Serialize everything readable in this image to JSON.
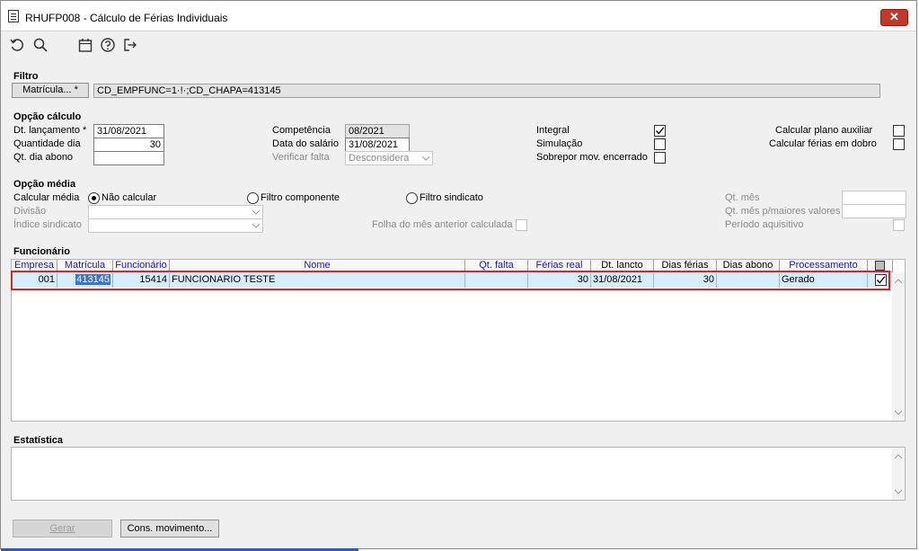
{
  "window": {
    "title": "RHUFP008 - Cálculo de Férias Individuais",
    "close_label": "✕"
  },
  "filtro": {
    "legend": "Filtro",
    "matricula_button": "Matrícula... *",
    "filter_value": "CD_EMPFUNC=1·!·;CD_CHAPA=413145"
  },
  "opcao_calculo": {
    "legend": "Opção cálculo",
    "dt_lancamento_label": "Dt. lançamento *",
    "dt_lancamento": "31/08/2021",
    "quantidade_dia_label": "Quantidade dia",
    "quantidade_dia": "30",
    "qt_dia_abono_label": "Qt. dia abono",
    "qt_dia_abono": "",
    "competencia_label": "Competência",
    "competencia": "08/2021",
    "data_salario_label": "Data do salário",
    "data_salario": "31/08/2021",
    "verificar_falta_label": "Verificar falta",
    "verificar_falta": "Desconsidera",
    "integral_label": "Integral",
    "integral_checked": true,
    "simulacao_label": "Simulação",
    "simulacao_checked": false,
    "sobrepor_label": "Sobrepor mov. encerrado",
    "sobrepor_checked": false,
    "plano_auxiliar_label": "Calcular plano auxiliar",
    "plano_auxiliar_checked": false,
    "ferias_dobro_label": "Calcular férias em dobro",
    "ferias_dobro_checked": false
  },
  "opcao_media": {
    "legend": "Opção média",
    "calcular_media_label": "Calcular média",
    "radio_nao_calcular": "Não calcular",
    "radio_filtro_componente": "Filtro componente",
    "radio_filtro_sindicato": "Filtro sindicato",
    "selected": "Não calcular",
    "divisao_label": "Divisão",
    "indice_sindicato_label": "Índice sindicato",
    "folha_mes_anterior_label": "Folha do mês anterior calculada",
    "qt_mes_label": "Qt. mês",
    "qt_mes_maiores_label": "Qt. mês p/maiores valores",
    "periodo_aquisitivo_label": "Período aquisitivo"
  },
  "funcionario": {
    "legend": "Funcionário",
    "columns": [
      "Empresa",
      "Matrícula",
      "Funcionário",
      "Nome",
      "Qt. falta",
      "Férias real",
      "Dt. lancto",
      "Dias férias",
      "Dias abono",
      "Processamento"
    ],
    "rows": [
      {
        "empresa": "001",
        "matricula": "413145",
        "funcionario": "15414",
        "nome": "FUNCIONARIO TESTE",
        "qt_falta": "",
        "ferias_real": "30",
        "dt_lancto": "31/08/2021",
        "dias_ferias": "30",
        "dias_abono": "",
        "processamento": "Gerado",
        "checked": true
      }
    ]
  },
  "estatistica": {
    "legend": "Estatística"
  },
  "actions": {
    "gerar": "Gerar",
    "cons_movimento": "Cons. movimento..."
  },
  "colors": {
    "accent": "#3b76c7",
    "row_highlight": "#d7262b",
    "selected_row": "#d6eefb",
    "header_text": "#1a1aa6"
  }
}
